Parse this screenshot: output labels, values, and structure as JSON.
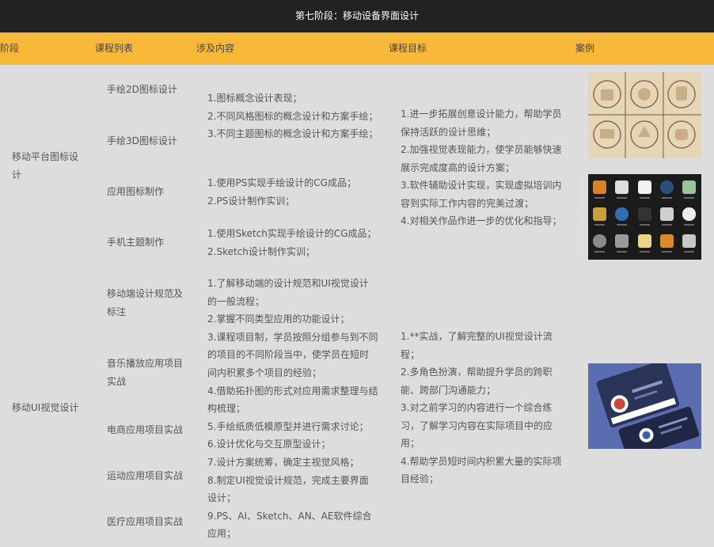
{
  "page": {
    "title": "第七阶段：移动设备界面设计"
  },
  "header": {
    "stage": "阶段",
    "courses": "课程列表",
    "content": "涉及内容",
    "goals": "课程目标",
    "cases": "案例"
  },
  "sections": [
    {
      "stage": "移动平台图标设计",
      "courses": [
        "手绘2D图标设计",
        "手绘3D图标设计",
        "应用图标制作",
        "手机主题制作"
      ],
      "content_groups": [
        [
          "1.图标概念设计表现；",
          "2.不同风格图标的概念设计和方案手绘；",
          "3.不同主题图标的概念设计和方案手绘；"
        ],
        [
          "1.使用PS实现手绘设计的CG成品；",
          "2.PS设计制作实训；"
        ],
        [
          "1.使用Sketch实现手绘设计的CG成品；",
          "2.Sketch设计制作实训；"
        ]
      ],
      "goals": [
        "1.进一步拓展创意设计能力，帮助学员",
        "保持活跃的设计思维；",
        "2.加强视觉表现能力，使学员能够快速",
        "展示完成度高的设计方案；",
        "3.软件辅助设计实现，实现虚拟培训内",
        "容到实际工作内容的完美过渡；",
        "4.对相关作品作进一步的优化和指导；"
      ],
      "case_images": [
        "hand-drawn-icons-case-image",
        "app-icon-theme-case-image"
      ]
    },
    {
      "stage": "移动UI视觉设计",
      "courses": [
        "移动端设计规范及",
        "标注",
        "音乐播放应用项目",
        "实战",
        "电商应用项目实战",
        "运动应用项目实战",
        "医疗应用项目实战"
      ],
      "content": [
        "1.了解移动端的设计规范和UI视觉设计",
        "的一般流程；",
        "2.掌握不同类型应用的功能设计；",
        "3.课程项目制，学员按照分组参与到不同",
        "的项目的不同阶段当中，使学员在短时",
        "间内积累多个项目的经验；",
        "4.借助拓扑图的形式对应用需求整理与结",
        "构梳理；",
        "5.手绘纸质低模原型并进行需求讨论；",
        "6.设计优化与交互原型设计；",
        "7.设计方案统筹，确定主视觉风格；",
        "8.制定UI视觉设计规范，完成主要界面",
        "设计；",
        "9.PS、AI、Sketch、AN、AE软件综合",
        "应用；"
      ],
      "goals": [
        "1.**实战，了解完整的UI视觉设计流",
        "程；",
        "2.多角色扮演，帮助提升学员的跨职",
        "能、跨部门沟通能力；",
        "3.对之前学习的内容进行一个综合练",
        "习，了解学习内容在实际项目中的应",
        "用；",
        "4.帮助学员短时间内积累大量的实际项",
        "目经验；"
      ],
      "case_images": [
        "ui-visual-case-image"
      ]
    }
  ],
  "colors": {
    "title_bg": "#222222",
    "header_bg": "#f8b93b",
    "body_bg": "#dddddd"
  }
}
